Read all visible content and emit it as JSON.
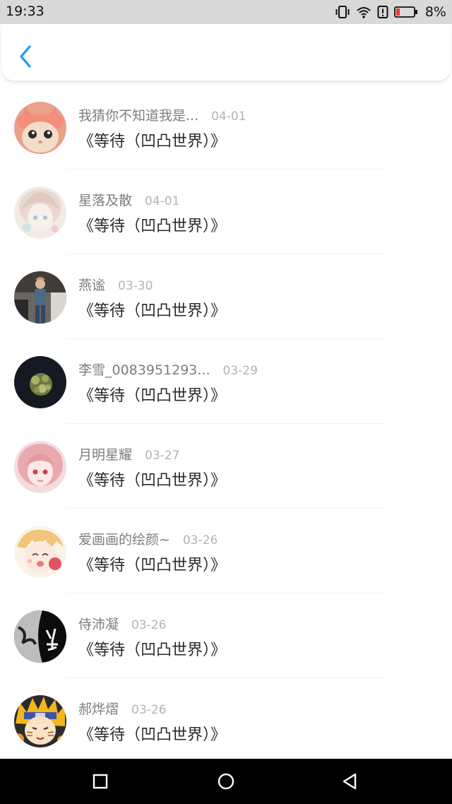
{
  "status_bar": {
    "time": "19:33",
    "battery_text": "8%",
    "icons": [
      "vibrate-icon",
      "wifi-icon",
      "alert-icon",
      "battery-low-icon"
    ]
  },
  "header": {
    "back_icon": "chevron-left-icon",
    "accent_color": "#1a9cf0"
  },
  "list": {
    "items": [
      {
        "name": "我猜你不知道我是...",
        "date": "04-01",
        "title": "《等待（凹凸世界）》",
        "avatar": "cat-avatar"
      },
      {
        "name": "星落及散",
        "date": "04-01",
        "title": "《等待（凹凸世界）》",
        "avatar": "anime-girl-pastel-avatar"
      },
      {
        "name": "燕谧",
        "date": "03-30",
        "title": "《等待（凹凸世界）》",
        "avatar": "person-photo-avatar"
      },
      {
        "name": "李雪_0083951293...",
        "date": "03-29",
        "title": "《等待（凹凸世界）》",
        "avatar": "flower-dark-avatar"
      },
      {
        "name": "月明星耀",
        "date": "03-27",
        "title": "《等待（凹凸世界）》",
        "avatar": "anime-pink-hair-avatar"
      },
      {
        "name": "爱画画的绘颜~",
        "date": "03-26",
        "title": "《等待（凹凸世界）》",
        "avatar": "anime-blonde-avatar"
      },
      {
        "name": "侍沛凝",
        "date": "03-26",
        "title": "《等待（凹凸世界）》",
        "avatar": "black-white-text-avatar"
      },
      {
        "name": "郝烨熠",
        "date": "03-26",
        "title": "《等待（凹凸世界）》",
        "avatar": "naruto-avatar"
      }
    ]
  },
  "nav_bar": {
    "buttons": [
      "recent-apps-icon",
      "home-icon",
      "back-triangle-icon"
    ]
  }
}
